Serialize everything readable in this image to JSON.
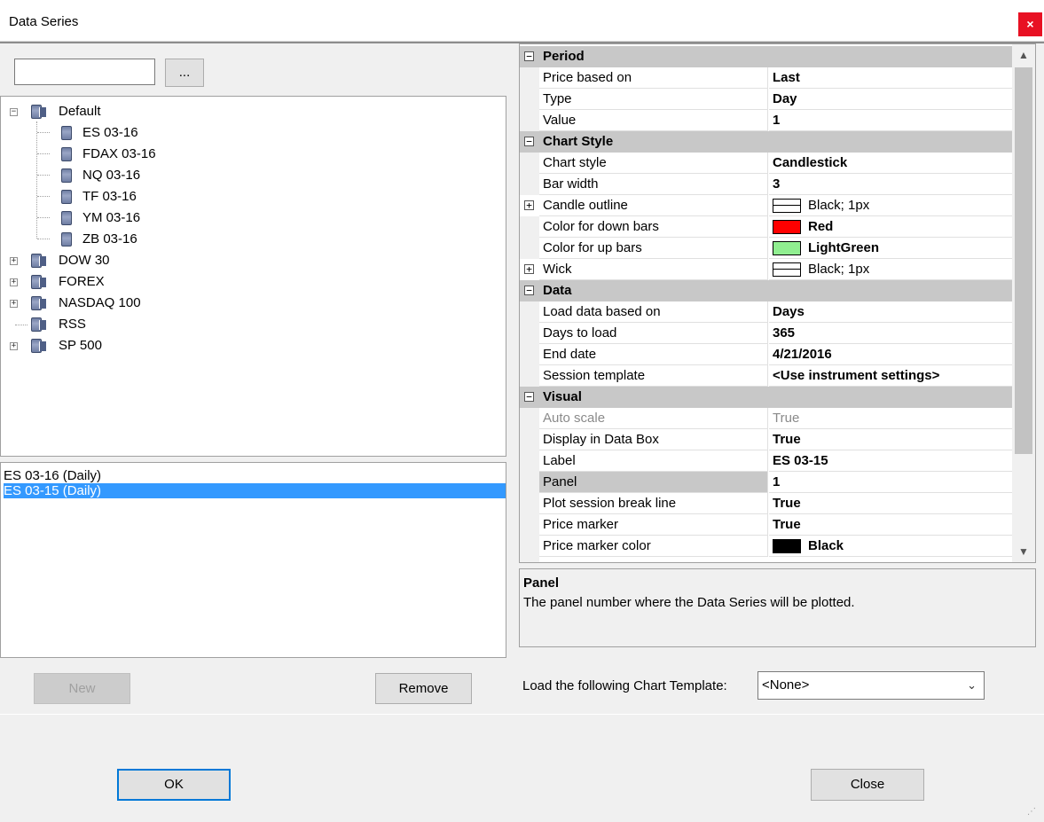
{
  "window": {
    "title": "Data Series",
    "close_label": "×"
  },
  "search": {
    "value": "",
    "browse_label": "..."
  },
  "tree": {
    "default_group": "Default",
    "default_children": [
      "ES 03-16",
      "FDAX 03-16",
      "NQ 03-16",
      "TF 03-16",
      "YM 03-16",
      "ZB 03-16"
    ],
    "groups": [
      "DOW 30",
      "FOREX",
      "NASDAQ 100",
      "RSS",
      "SP 500"
    ]
  },
  "series_list": {
    "items": [
      "ES 03-16 (Daily)",
      "ES 03-15 (Daily)"
    ],
    "selected_index": 1
  },
  "buttons": {
    "new": "New",
    "remove": "Remove",
    "ok": "OK",
    "close": "Close"
  },
  "properties": {
    "period": {
      "title": "Period",
      "price_based_on": {
        "name": "Price based on",
        "value": "Last"
      },
      "type": {
        "name": "Type",
        "value": "Day"
      },
      "value": {
        "name": "Value",
        "value": "1"
      }
    },
    "chart_style": {
      "title": "Chart Style",
      "chart_style": {
        "name": "Chart style",
        "value": "Candlestick"
      },
      "bar_width": {
        "name": "Bar width",
        "value": "3"
      },
      "candle_outline": {
        "name": "Candle outline",
        "value": "Black; 1px",
        "color": "#ffffff"
      },
      "down_bars": {
        "name": "Color for down bars",
        "value": "Red",
        "color": "#ff0000"
      },
      "up_bars": {
        "name": "Color for up bars",
        "value": "LightGreen",
        "color": "#90ee90"
      },
      "wick": {
        "name": "Wick",
        "value": "Black; 1px",
        "color": "#ffffff"
      }
    },
    "data": {
      "title": "Data",
      "load_based_on": {
        "name": "Load data based on",
        "value": "Days"
      },
      "days_to_load": {
        "name": "Days to load",
        "value": "365"
      },
      "end_date": {
        "name": "End date",
        "value": "4/21/2016"
      },
      "session_template": {
        "name": "Session template",
        "value": "<Use instrument settings>"
      }
    },
    "visual": {
      "title": "Visual",
      "auto_scale": {
        "name": "Auto scale",
        "value": "True"
      },
      "display_in_data_box": {
        "name": "Display in Data Box",
        "value": "True"
      },
      "label": {
        "name": "Label",
        "value": "ES 03-15"
      },
      "panel": {
        "name": "Panel",
        "value": "1"
      },
      "plot_session_break": {
        "name": "Plot session break line",
        "value": "True"
      },
      "price_marker": {
        "name": "Price marker",
        "value": "True"
      },
      "price_marker_color": {
        "name": "Price marker color",
        "value": "Black",
        "color": "#000000"
      }
    }
  },
  "description": {
    "title": "Panel",
    "text": "The panel number where the Data Series will be plotted."
  },
  "chart_template": {
    "label": "Load the following Chart Template:",
    "value": "<None>"
  },
  "colors": {
    "selection": "#3399ff",
    "category_bg": "#c8c8c8",
    "close_red": "#e81123"
  }
}
